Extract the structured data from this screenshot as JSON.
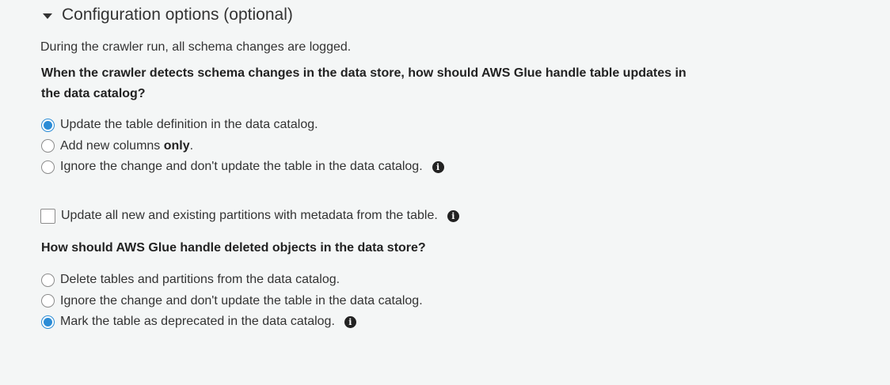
{
  "section": {
    "title": "Configuration options (optional)"
  },
  "note": "During the crawler run, all schema changes are logged.",
  "schema_changes": {
    "question": "When the crawler detects schema changes in the data store, how should AWS Glue handle table updates in the data catalog?",
    "options": [
      {
        "label": "Update the table definition in the data catalog.",
        "checked": true
      },
      {
        "label_prefix": "Add new columns ",
        "label_bold": "only",
        "label_suffix": ".",
        "checked": false
      },
      {
        "label": "Ignore the change and don't update the table in the data catalog.",
        "checked": false
      }
    ]
  },
  "partitions_checkbox": {
    "label": "Update all new and existing partitions with metadata from the table.",
    "checked": false
  },
  "deleted_objects": {
    "question": "How should AWS Glue handle deleted objects in the data store?",
    "options": [
      {
        "label": "Delete tables and partitions from the data catalog.",
        "checked": false
      },
      {
        "label": "Ignore the change and don't update the table in the data catalog.",
        "checked": false
      },
      {
        "label": "Mark the table as deprecated in the data catalog.",
        "checked": true
      }
    ]
  },
  "icons": {
    "caret": "caret-down-icon",
    "info": "info-icon",
    "info_glyph": "i"
  },
  "colors": {
    "accent": "#2b8cd6",
    "background": "#f4f6f6",
    "text": "#333333"
  }
}
